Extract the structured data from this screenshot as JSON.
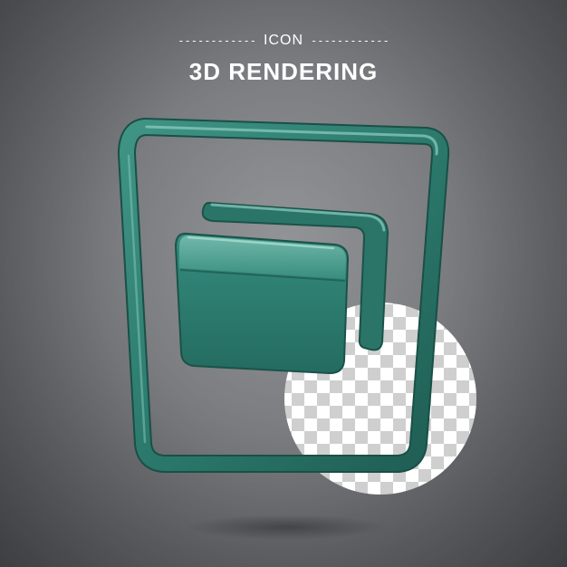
{
  "header": {
    "dashes_left": "------------",
    "label": "ICON",
    "dashes_right": "------------",
    "title": "3D RENDERING"
  },
  "colors": {
    "background": "#7a7c80",
    "icon_teal": "#2e7f72",
    "icon_teal_dark": "#1d5a50",
    "icon_highlight": "#6fb3a6"
  },
  "icon": {
    "subject": "wallet-cards-frame-icon"
  }
}
